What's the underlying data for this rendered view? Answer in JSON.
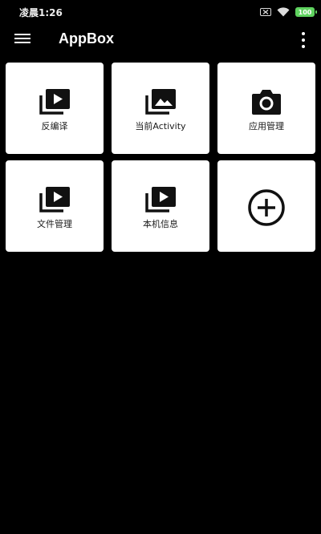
{
  "status_bar": {
    "time": "凌晨1:26",
    "battery": "100",
    "icons": [
      "sim-off-icon",
      "wifi-icon",
      "battery-icon"
    ]
  },
  "app_bar": {
    "title": "AppBox",
    "menu_icon": "menu-icon",
    "overflow_icon": "more-vert-icon"
  },
  "tiles": [
    {
      "label": "反编译",
      "icon": "video-library-icon"
    },
    {
      "label": "当前Activity",
      "icon": "photo-library-icon"
    },
    {
      "label": "应用管理",
      "icon": "camera-icon"
    },
    {
      "label": "文件管理",
      "icon": "video-library-icon"
    },
    {
      "label": "本机信息",
      "icon": "video-library-icon"
    },
    {
      "label": "",
      "icon": "add-circle-icon"
    }
  ],
  "colors": {
    "background": "#000000",
    "tile": "#ffffff",
    "icon": "#111111",
    "battery": "#5fd35f"
  }
}
